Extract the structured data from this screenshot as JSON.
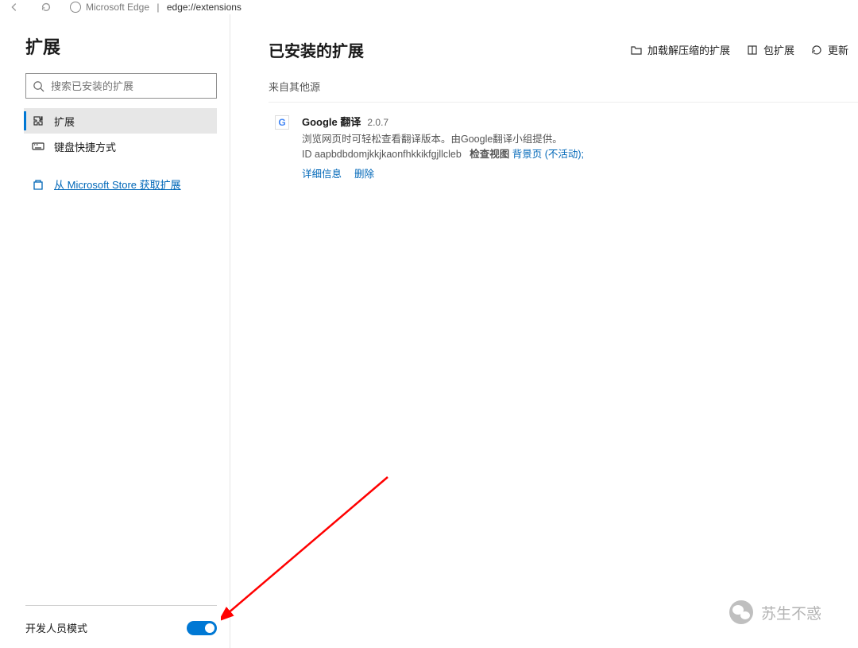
{
  "topbar": {
    "tab_title": "Microsoft Edge",
    "url_display": "edge://extensions"
  },
  "sidebar": {
    "title": "扩展",
    "search_placeholder": "搜索已安装的扩展",
    "nav": {
      "extensions": "扩展",
      "shortcuts": "键盘快捷方式"
    },
    "store_link": "从 Microsoft Store 获取扩展",
    "dev_mode_label": "开发人员模式"
  },
  "header": {
    "title": "已安装的扩展",
    "actions": {
      "load_unpacked": "加载解压缩的扩展",
      "pack": "包扩展",
      "update": "更新"
    }
  },
  "sections": {
    "from_other": "来自其他源"
  },
  "extension": {
    "name": "Google 翻译",
    "version": "2.0.7",
    "description": "浏览网页时可轻松查看翻译版本。由Google翻译小组提供。",
    "id_label": "ID",
    "id": "aapbdbdomjkkjkaonfhkkikfgjllcleb",
    "inspect_label": "检查视图",
    "background_link": "背景页 (不活动);",
    "details": "详细信息",
    "remove": "删除"
  },
  "watermark": "苏生不惑"
}
